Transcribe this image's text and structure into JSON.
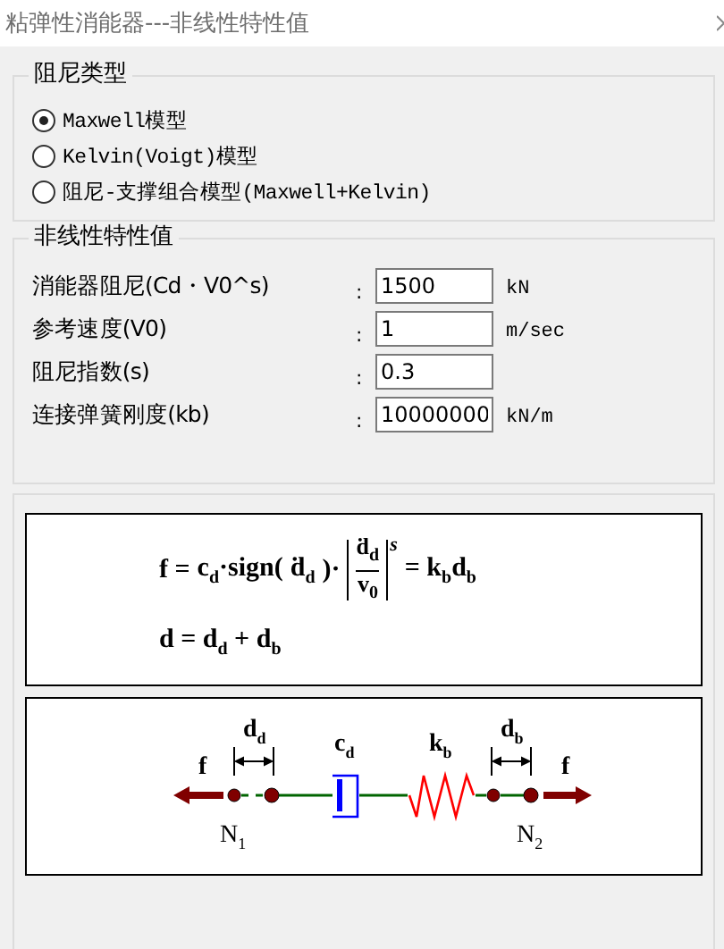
{
  "window": {
    "title": "粘弹性消能器---非线性特性值"
  },
  "damping_group": {
    "title": "阻尼类型",
    "options": [
      {
        "label": "Maxwell模型",
        "selected": true
      },
      {
        "label": "Kelvin(Voigt)模型",
        "selected": false
      },
      {
        "label": "阻尼-支撑组合模型(Maxwell+Kelvin)",
        "selected": false
      }
    ]
  },
  "properties_group": {
    "title": "非线性特性值",
    "fields": [
      {
        "label": "消能器阻尼(Cd・V0^s)",
        "colon": ":",
        "value": "1500",
        "unit": "kN"
      },
      {
        "label": "参考速度(V0)",
        "colon": ":",
        "value": "1",
        "unit": "m/sec"
      },
      {
        "label": "阻尼指数(s)",
        "colon": ":",
        "value": "0.3"
      },
      {
        "label": "连接弹簧刚度(kb)",
        "colon": ":",
        "value": "10000000",
        "unit": "kN/m"
      }
    ]
  },
  "formula": {
    "equation_1": {
      "lhs": "f =",
      "factor": "c$_{d}$·sign(",
      "argument": "ḋ$_{d}$",
      "close": ")·",
      "numerator": "ḋ$_{d}$",
      "denominator": "v$_{0}$",
      "exponent": "s",
      "rhs": "= k$_{b}$d$_{b}$"
    },
    "equation_2": "d = d$_{d}$ + d$_{b}$"
  },
  "diagram": {
    "left_force": "f",
    "right_force": "f",
    "damper_displacement": "d$_{d}$",
    "damper_coefficient": "c$_{d}$",
    "spring_stiffness": "k$_{b}$",
    "spring_displacement": "d$_{b}$",
    "node_1": "N$_{1}$",
    "node_2": "N$_{2}$"
  }
}
